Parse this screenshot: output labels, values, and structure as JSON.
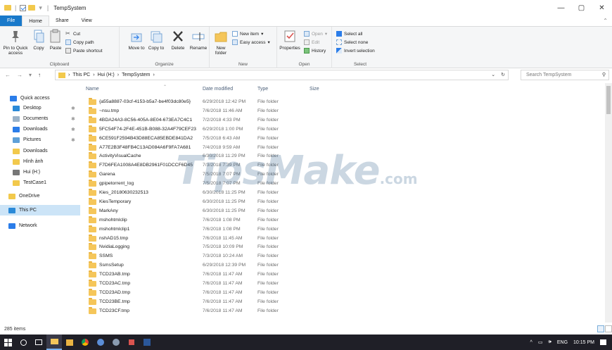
{
  "window": {
    "title": "TempSystem",
    "controls": {
      "minimize": "—",
      "maximize": "▢",
      "close": "✕"
    }
  },
  "ribbon_tabs": [
    "File",
    "Home",
    "Share",
    "View"
  ],
  "ribbon": {
    "clipboard": {
      "pin_label": "Pin to Quick access",
      "copy_label": "Copy",
      "paste_label": "Paste",
      "cut_label": "Cut",
      "copy_path_label": "Copy path",
      "paste_shortcut_label": "Paste shortcut",
      "group_label": "Clipboard"
    },
    "organize": {
      "move_to_label": "Move to",
      "copy_to_label": "Copy to",
      "delete_label": "Delete",
      "rename_label": "Rename",
      "group_label": "Organize"
    },
    "new": {
      "new_folder_label": "New folder",
      "new_item_label": "New item",
      "easy_access_label": "Easy access",
      "group_label": "New"
    },
    "open": {
      "properties_label": "Properties",
      "open_label": "Open",
      "edit_label": "Edit",
      "history_label": "History",
      "group_label": "Open"
    },
    "select": {
      "select_all_label": "Select all",
      "select_none_label": "Select none",
      "invert_label": "Invert selection",
      "group_label": "Select"
    }
  },
  "address": {
    "crumbs": [
      "This PC",
      "Hui (H:)",
      "TempSystem"
    ],
    "search_placeholder": "Search TempSystem"
  },
  "nav_pane": {
    "items": [
      {
        "label": "Quick access",
        "icon": "star-icon",
        "color": "#2b7de9"
      },
      {
        "label": "Desktop",
        "icon": "desktop-icon",
        "color": "#2b8ad8",
        "pinned": true
      },
      {
        "label": "Documents",
        "icon": "documents-icon",
        "color": "#9bb3c9",
        "pinned": true
      },
      {
        "label": "Downloads",
        "icon": "downloads-icon",
        "color": "#2b7de9",
        "pinned": true
      },
      {
        "label": "Pictures",
        "icon": "pictures-icon",
        "color": "#5ea0d8",
        "pinned": true
      },
      {
        "label": "Downloads",
        "icon": "folder-icon",
        "color": "#f2c94c"
      },
      {
        "label": "Hình ảnh",
        "icon": "folder-icon",
        "color": "#f2c94c"
      },
      {
        "label": "Hui (H:)",
        "icon": "drive-icon",
        "color": "#777777"
      },
      {
        "label": "TestCase1",
        "icon": "folder-icon",
        "color": "#f2c94c"
      },
      {
        "label": "OneDrive",
        "icon": "onedrive-icon",
        "color": "#f2c94c"
      },
      {
        "label": "This PC",
        "icon": "pc-icon",
        "color": "#2b8ad8",
        "selected": true
      },
      {
        "label": "Network",
        "icon": "network-icon",
        "color": "#2b7de9"
      }
    ]
  },
  "columns": {
    "name": "Name",
    "date": "Date modified",
    "type": "Type",
    "size": "Size"
  },
  "files": [
    {
      "name": "{a55a8887-03cf-4153-b5a7-be4f03dc80e5}",
      "date": "6/29/2018 12:42 PM",
      "type": "File folder"
    },
    {
      "name": "~nsu.tmp",
      "date": "7/6/2018 11:46 AM",
      "type": "File folder"
    },
    {
      "name": "4BDA24A3-8C56-405A-8E04-673EA7C4C1",
      "date": "7/2/2018 4:33 PM",
      "type": "File folder"
    },
    {
      "name": "5FC54F74-2F4E-451B-B088-32A4F79CEF23",
      "date": "6/29/2018 1:00 PM",
      "type": "File folder"
    },
    {
      "name": "6CE591F2594B43D88ECA85EBDE841DA2",
      "date": "7/5/2018 6:43 AM",
      "type": "File folder"
    },
    {
      "name": "A77E2B3F48FB4C13AD084A6F9FA7A681",
      "date": "7/4/2018 9:59 AM",
      "type": "File folder"
    },
    {
      "name": "ActivityVisualCache",
      "date": "6/30/2018 11:29 PM",
      "type": "File folder"
    },
    {
      "name": "F7D6FEA1008A4E8DB2961F01DCCF6D45",
      "date": "7/3/2018 7:39 PM",
      "type": "File folder"
    },
    {
      "name": "Garena",
      "date": "7/5/2018 7:07 PM",
      "type": "File folder"
    },
    {
      "name": "gpipetorrent_log",
      "date": "7/5/2018 7:07 PM",
      "type": "File folder"
    },
    {
      "name": "Kies_20180630232513",
      "date": "6/30/2018 11:25 PM",
      "type": "File folder"
    },
    {
      "name": "KiesTemporary",
      "date": "6/30/2018 11:25 PM",
      "type": "File folder"
    },
    {
      "name": "MarkAny",
      "date": "6/30/2018 11:25 PM",
      "type": "File folder"
    },
    {
      "name": "mshohtmlclip",
      "date": "7/6/2018 1:08 PM",
      "type": "File folder"
    },
    {
      "name": "mshohtmlclip1",
      "date": "7/6/2018 1:08 PM",
      "type": "File folder"
    },
    {
      "name": "nshAD15.tmp",
      "date": "7/6/2018 11:45 AM",
      "type": "File folder"
    },
    {
      "name": "NvidiaLogging",
      "date": "7/5/2018 10:09 PM",
      "type": "File folder"
    },
    {
      "name": "SSMS",
      "date": "7/3/2018 10:24 AM",
      "type": "File folder"
    },
    {
      "name": "SsmsSetup",
      "date": "6/29/2018 12:39 PM",
      "type": "File folder"
    },
    {
      "name": "TCD23AB.tmp",
      "date": "7/6/2018 11:47 AM",
      "type": "File folder"
    },
    {
      "name": "TCD23AC.tmp",
      "date": "7/6/2018 11:47 AM",
      "type": "File folder"
    },
    {
      "name": "TCD23AD.tmp",
      "date": "7/6/2018 11:47 AM",
      "type": "File folder"
    },
    {
      "name": "TCD23BE.tmp",
      "date": "7/6/2018 11:47 AM",
      "type": "File folder"
    },
    {
      "name": "TCD23CF.tmp",
      "date": "7/6/2018 11:47 AM",
      "type": "File folder"
    }
  ],
  "watermark": {
    "main": "TipsMake",
    "suffix": ".com"
  },
  "status": {
    "count": "285 items"
  },
  "taskbar": {
    "tray_lang": "ENG",
    "time": "10:15 PM"
  }
}
